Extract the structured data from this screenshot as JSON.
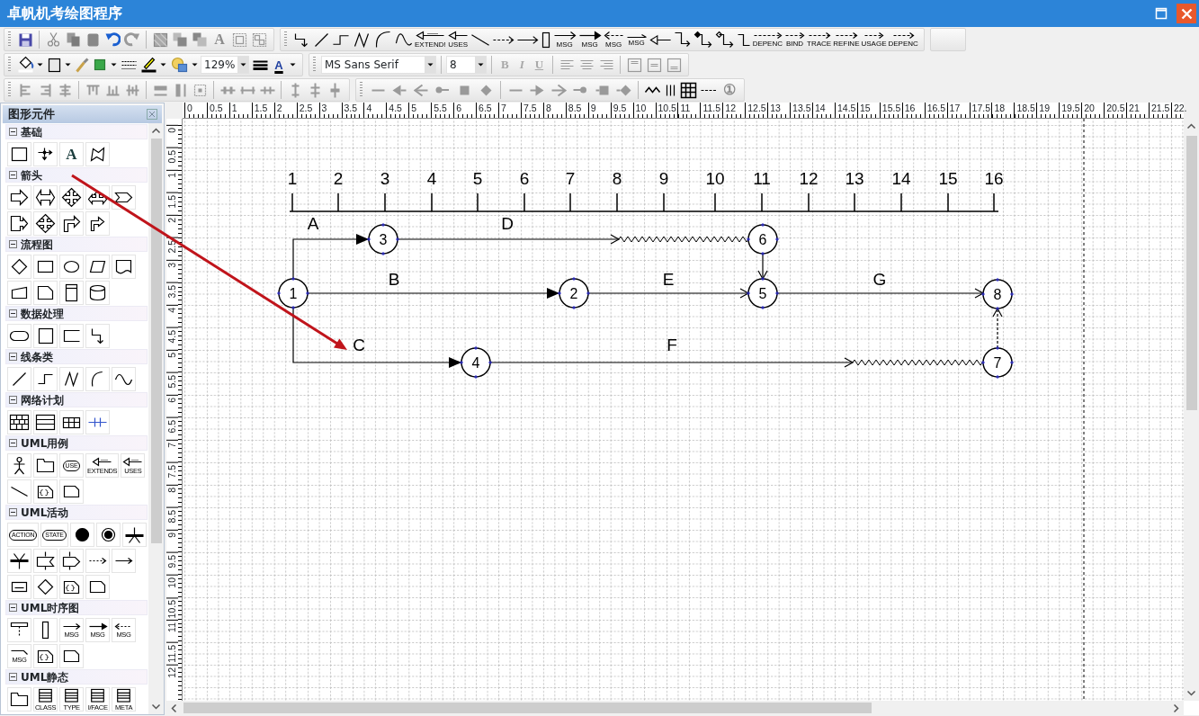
{
  "window": {
    "title": "卓帆机考绘图程序"
  },
  "toolbars": [
    {
      "tool_labels": [
        "A",
        "EXTEND!",
        "USES",
        "MSG",
        "MSG",
        "MSG",
        "MSG",
        "DEPENC",
        "BIND",
        "TRACE",
        "REFINE",
        "USAGE",
        "DEPENC"
      ]
    },
    {
      "zoom": "129%",
      "font_color_label": "A",
      "font": "MS Sans Serif",
      "font_size": "8",
      "style_buttons": [
        {
          "label": "B",
          "disabled": true
        },
        {
          "label": "I",
          "disabled": true
        },
        {
          "label": "U",
          "disabled": true
        }
      ]
    },
    {
      "tool_labels": [
        "①"
      ]
    }
  ],
  "palette": {
    "title": "图形元件",
    "sections": [
      {
        "title": "基础",
        "expanded": true,
        "tool_labels": [
          "A"
        ]
      },
      {
        "title": "箭头",
        "expanded": true
      },
      {
        "title": "流程图",
        "expanded": true
      },
      {
        "title": "数据处理",
        "expanded": true
      },
      {
        "title": "线条类",
        "expanded": true
      },
      {
        "title": "网络计划",
        "expanded": true
      },
      {
        "title": "UML用例",
        "expanded": true,
        "tool_labels": [
          "USE",
          "EXTENDS",
          "USES"
        ]
      },
      {
        "title": "UML活动",
        "expanded": true,
        "tool_labels": [
          "ACTION",
          "STATE"
        ]
      },
      {
        "title": "UML时序图",
        "expanded": true,
        "tool_labels": [
          "MSG",
          "MSG",
          "MSG",
          "MSG"
        ]
      },
      {
        "title": "UML静态",
        "expanded": true,
        "tool_labels": [
          "CLASS",
          "TYPE",
          "I/FACE",
          "META"
        ]
      }
    ]
  },
  "ruler": {
    "horizontal": [
      "0",
      "0.5",
      "1",
      "1.5",
      "2",
      "2.5",
      "3",
      "3.5",
      "4",
      "4.5",
      "5",
      "5.5",
      "6",
      "6.5",
      "7",
      "7.5",
      "8",
      "8.5",
      "9",
      "9.5",
      "10",
      "10.5",
      "11",
      "11.5",
      "12",
      "12.5",
      "13",
      "13.5",
      "14",
      "14.5",
      "15",
      "15.5",
      "16",
      "16.5",
      "17",
      "17.5",
      "18",
      "18.5",
      "19",
      "19.5",
      "20",
      "20.5",
      "21",
      "21.5",
      "22."
    ],
    "vertical": [
      "0",
      "0.5",
      "1",
      "1.5",
      "2",
      "2.5",
      "3",
      "3.5",
      "4",
      "4.5",
      "5",
      "5.5",
      "6",
      "6.5",
      "7",
      "7.5",
      "8",
      "8.5",
      "9",
      "9.5",
      "10",
      "10.5",
      "11",
      "11.5",
      "12"
    ]
  },
  "diagram": {
    "time_scale": [
      "1",
      "2",
      "3",
      "4",
      "5",
      "6",
      "7",
      "8",
      "9",
      "10",
      "11",
      "12",
      "13",
      "14",
      "15",
      "16"
    ],
    "nodes": [
      {
        "label": "1"
      },
      {
        "label": "2"
      },
      {
        "label": "3"
      },
      {
        "label": "4"
      },
      {
        "label": "5"
      },
      {
        "label": "6"
      },
      {
        "label": "7"
      },
      {
        "label": "8"
      }
    ],
    "arrows": [
      {
        "label": "A",
        "kind": "filled"
      },
      {
        "label": "B",
        "kind": "filled"
      },
      {
        "label": "C",
        "kind": "filled"
      },
      {
        "label": "D",
        "kind": "wavy"
      },
      {
        "label": "E",
        "kind": "open"
      },
      {
        "label": "F",
        "kind": "wavy"
      },
      {
        "label": "G",
        "kind": "open"
      },
      {
        "kind": "open"
      },
      {
        "kind": "dashed"
      }
    ]
  }
}
